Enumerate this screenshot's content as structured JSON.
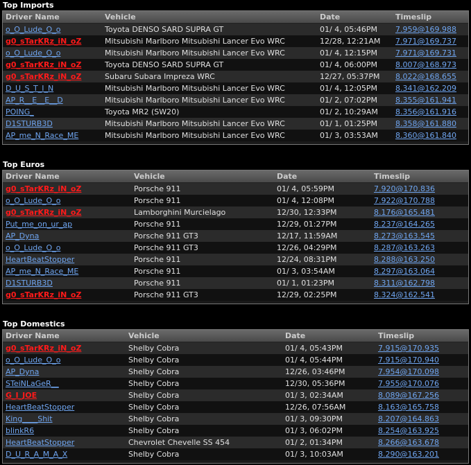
{
  "colors": {
    "background": "#000000",
    "link": "#6fa5f0",
    "highlight": "#ff1a1a"
  },
  "headers": {
    "driver": "Driver Name",
    "vehicle": "Vehicle",
    "date": "Date",
    "timeslip": "Timeslip"
  },
  "sections": [
    {
      "title": "Top Imports",
      "rows": [
        {
          "driver": "o_O_Lude_O_o",
          "red": false,
          "vehicle": "Toyota DENSO SARD SUPRA GT",
          "date": "01/ 4, 05:46PM",
          "timeslip": "7.959@169.988"
        },
        {
          "driver": "g0_sTarKRz_iN_oZ",
          "red": true,
          "vehicle": "Mitsubishi Marlboro Mitsubishi Lancer Evo WRC",
          "date": "12/28, 12:21AM",
          "timeslip": "7.971@169.737"
        },
        {
          "driver": "o_O_Lude_O_o",
          "red": false,
          "vehicle": "Mitsubishi Marlboro Mitsubishi Lancer Evo WRC",
          "date": "01/ 4, 12:15PM",
          "timeslip": "7.971@169.731"
        },
        {
          "driver": "g0_sTarKRz_iN_oZ",
          "red": true,
          "vehicle": "Toyota DENSO SARD SUPRA GT",
          "date": "01/ 4, 06:00PM",
          "timeslip": "8.007@168.973"
        },
        {
          "driver": "g0_sTarKRz_iN_oZ",
          "red": true,
          "vehicle": "Subaru Subara Impreza WRC",
          "date": "12/27, 05:37PM",
          "timeslip": "8.022@168.655"
        },
        {
          "driver": "D_U_S_T_I_N",
          "red": false,
          "vehicle": "Mitsubishi Marlboro Mitsubishi Lancer Evo WRC",
          "date": "01/ 4, 12:05PM",
          "timeslip": "8.341@162.209"
        },
        {
          "driver": "AP_R__E__E__D",
          "red": false,
          "vehicle": "Mitsubishi Marlboro Mitsubishi Lancer Evo WRC",
          "date": "01/ 2, 07:02PM",
          "timeslip": "8.355@161.941"
        },
        {
          "driver": "POING_",
          "red": false,
          "vehicle": "Toyota MR2 (SW20)",
          "date": "01/ 2, 10:29AM",
          "timeslip": "8.356@161.916"
        },
        {
          "driver": "D1STURB3D",
          "red": false,
          "vehicle": "Mitsubishi Marlboro Mitsubishi Lancer Evo WRC",
          "date": "01/ 1, 01:25PM",
          "timeslip": "8.358@161.880"
        },
        {
          "driver": "AP_me_N_Race_ME",
          "red": false,
          "vehicle": "Mitsubishi Marlboro Mitsubishi Lancer Evo WRC",
          "date": "01/ 3, 03:53AM",
          "timeslip": "8.360@161.840"
        }
      ]
    },
    {
      "title": "Top Euros",
      "rows": [
        {
          "driver": "g0_sTarKRz_iN_oZ",
          "red": true,
          "vehicle": "Porsche 911",
          "date": "01/ 4, 05:59PM",
          "timeslip": "7.920@170.836"
        },
        {
          "driver": "o_O_Lude_O_o",
          "red": false,
          "vehicle": "Porsche 911",
          "date": "01/ 4, 12:08PM",
          "timeslip": "7.922@170.788"
        },
        {
          "driver": "g0_sTarKRz_iN_oZ",
          "red": true,
          "vehicle": "Lamborghini Murcielago",
          "date": "12/30, 12:33PM",
          "timeslip": "8.176@165.481"
        },
        {
          "driver": "Put_me_on_ur_ap",
          "red": false,
          "vehicle": "Porsche 911",
          "date": "12/29, 01:27PM",
          "timeslip": "8.237@164.265"
        },
        {
          "driver": "AP_Dyna",
          "red": false,
          "vehicle": "Porsche 911 GT3",
          "date": "12/17, 11:59AM",
          "timeslip": "8.273@163.545"
        },
        {
          "driver": "o_O_Lude_O_o",
          "red": false,
          "vehicle": "Porsche 911 GT3",
          "date": "12/26, 04:29PM",
          "timeslip": "8.287@163.263"
        },
        {
          "driver": "HeartBeatStopper",
          "red": false,
          "vehicle": "Porsche 911",
          "date": "12/24, 08:31PM",
          "timeslip": "8.288@163.250"
        },
        {
          "driver": "AP_me_N_Race_ME",
          "red": false,
          "vehicle": "Porsche 911",
          "date": "01/ 3, 03:54AM",
          "timeslip": "8.297@163.064"
        },
        {
          "driver": "D1STURB3D",
          "red": false,
          "vehicle": "Porsche 911",
          "date": "01/ 1, 01:23PM",
          "timeslip": "8.311@162.798"
        },
        {
          "driver": "g0_sTarKRz_iN_oZ",
          "red": true,
          "vehicle": "Porsche 911 GT3",
          "date": "12/29, 02:25PM",
          "timeslip": "8.324@162.541"
        }
      ]
    },
    {
      "title": "Top Domestics",
      "rows": [
        {
          "driver": "g0_sTarKRz_iN_oZ",
          "red": true,
          "vehicle": "Shelby Cobra",
          "date": "01/ 4, 05:43PM",
          "timeslip": "7.915@170.935"
        },
        {
          "driver": "o_O_Lude_O_o",
          "red": false,
          "vehicle": "Shelby Cobra",
          "date": "01/ 4, 05:44PM",
          "timeslip": "7.915@170.940"
        },
        {
          "driver": "AP_Dyna",
          "red": false,
          "vehicle": "Shelby Cobra",
          "date": "12/26, 03:46PM",
          "timeslip": "7.954@170.098"
        },
        {
          "driver": "STeiNLaGeR__",
          "red": false,
          "vehicle": "Shelby Cobra",
          "date": "12/30, 05:36PM",
          "timeslip": "7.955@170.076"
        },
        {
          "driver": "G_I_JOE",
          "red": true,
          "vehicle": "Shelby Cobra",
          "date": "01/ 3, 02:34AM",
          "timeslip": "8.089@167.256"
        },
        {
          "driver": "HeartBeatStopper",
          "red": false,
          "vehicle": "Shelby Cobra",
          "date": "12/26, 07:56AM",
          "timeslip": "8.163@165.758"
        },
        {
          "driver": "King____Shit",
          "red": false,
          "vehicle": "Shelby Cobra",
          "date": "01/ 3, 09:30PM",
          "timeslip": "8.207@164.863"
        },
        {
          "driver": "blinkR6",
          "red": false,
          "vehicle": "Shelby Cobra",
          "date": "01/ 3, 06:02PM",
          "timeslip": "8.254@163.925"
        },
        {
          "driver": "HeartBeatStopper",
          "red": false,
          "vehicle": "Chevrolet Chevelle SS 454",
          "date": "01/ 2, 01:34PM",
          "timeslip": "8.266@163.678"
        },
        {
          "driver": "D_U_R_A_M_A_X",
          "red": false,
          "vehicle": "Shelby Cobra",
          "date": "01/ 3, 10:03AM",
          "timeslip": "8.290@163.201"
        }
      ]
    }
  ]
}
